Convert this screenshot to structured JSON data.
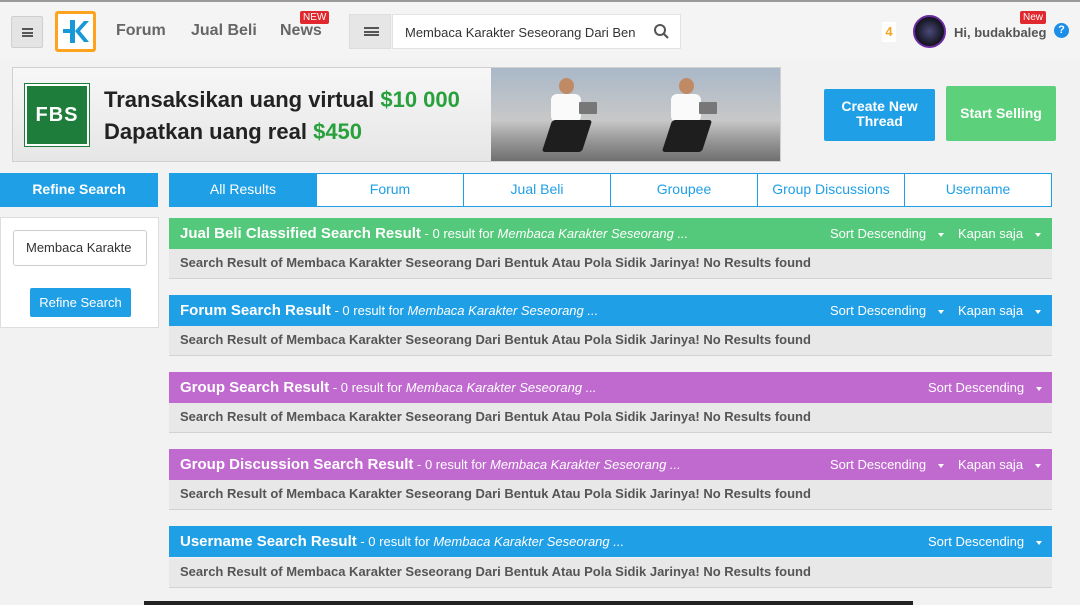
{
  "header": {
    "nav": [
      "Forum",
      "Jual Beli",
      "News"
    ],
    "news_badge": "NEW",
    "search_value": "Membaca Karakter Seseorang Dari Ben",
    "notification_count": "4",
    "greeting": "Hi, budakbaleg",
    "user_badge": "New"
  },
  "banner": {
    "logo_text": "FBS",
    "line1_text": "Transaksikan uang virtual ",
    "line1_amount": "$10 000",
    "line2_text": "Dapatkan uang real ",
    "line2_amount": "$450"
  },
  "actions": {
    "create_thread": "Create New Thread",
    "start_selling": "Start Selling"
  },
  "refine": {
    "header": "Refine Search",
    "input_value": "Membaca Karakte",
    "button": "Refine Search"
  },
  "tabs": [
    "All Results",
    "Forum",
    "Jual Beli",
    "Groupee",
    "Group Discussions",
    "Username"
  ],
  "sections": [
    {
      "title": "Jual Beli Classified Search Result",
      "info": " - 0 result for ",
      "query": "Membaca Karakter Seseorang ...",
      "sort": "Sort Descending",
      "time": "Kapan saja",
      "message": "Search Result of Membaca Karakter Seseorang Dari Bentuk Atau Pola Sidik Jarinya! No Results found",
      "color": "#55c97b"
    },
    {
      "title": "Forum Search Result",
      "info": " - 0 result for ",
      "query": "Membaca Karakter Seseorang ...",
      "sort": "Sort Descending",
      "time": "Kapan saja",
      "message": "Search Result of Membaca Karakter Seseorang Dari Bentuk Atau Pola Sidik Jarinya! No Results found",
      "color": "#1f9fe6"
    },
    {
      "title": "Group Search Result",
      "info": " - 0 result for ",
      "query": "Membaca Karakter Seseorang ...",
      "sort": "Sort Descending",
      "message": "Search Result of Membaca Karakter Seseorang Dari Bentuk Atau Pola Sidik Jarinya! No Results found",
      "color": "#c06ad0"
    },
    {
      "title": "Group Discussion Search Result",
      "info": " - 0 result for ",
      "query": "Membaca Karakter Seseorang ...",
      "sort": "Sort Descending",
      "time": "Kapan saja",
      "message": "Search Result of Membaca Karakter Seseorang Dari Bentuk Atau Pola Sidik Jarinya! No Results found",
      "color": "#c06ad0"
    },
    {
      "title": "Username Search Result",
      "info": " - 0 result for ",
      "query": "Membaca Karakter Seseorang ...",
      "sort": "Sort Descending",
      "message": "Search Result of Membaca Karakter Seseorang Dari Bentuk Atau Pola Sidik Jarinya! No Results found",
      "color": "#1f9fe6"
    }
  ]
}
